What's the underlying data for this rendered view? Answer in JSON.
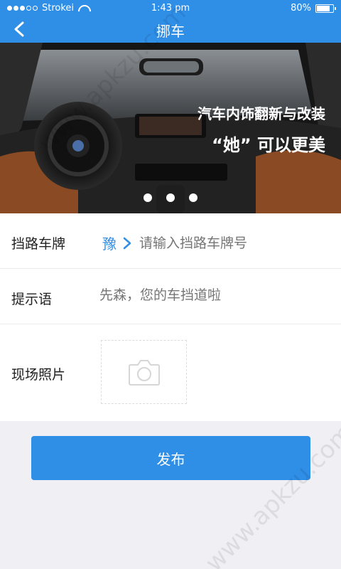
{
  "status_bar": {
    "carrier": "Strokei",
    "time": "1:43 pm",
    "battery": "80%",
    "battery_level": 0.8
  },
  "nav": {
    "title": "挪车",
    "back_icon": "chevron-left-icon"
  },
  "banner": {
    "headline": "汽车内饰翻新与改装",
    "subline": "“她” 可以更美",
    "pages": 3
  },
  "form": {
    "plate": {
      "label": "挡路车牌",
      "province": "豫",
      "placeholder": "请输入挡路车牌号"
    },
    "tip": {
      "label": "提示语",
      "placeholder": "先森，您的车挡道啦"
    },
    "photo": {
      "label": "现场照片",
      "icon": "camera-icon"
    }
  },
  "actions": {
    "publish_label": "发布"
  },
  "watermark": "www.apkzu.com",
  "colors": {
    "accent": "#2f8ee6",
    "background": "#efeff4"
  }
}
